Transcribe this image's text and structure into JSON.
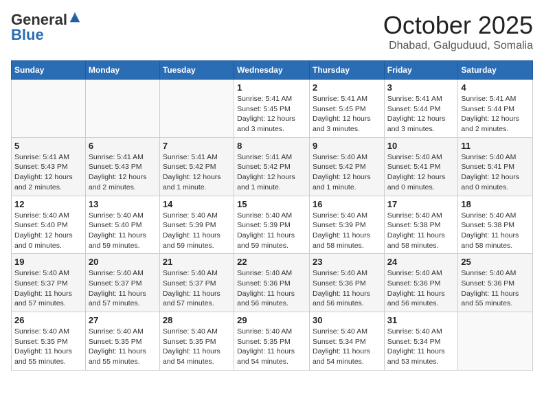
{
  "logo": {
    "general": "General",
    "blue": "Blue"
  },
  "header": {
    "month": "October 2025",
    "location": "Dhabad, Galguduud, Somalia"
  },
  "weekdays": [
    "Sunday",
    "Monday",
    "Tuesday",
    "Wednesday",
    "Thursday",
    "Friday",
    "Saturday"
  ],
  "weeks": [
    [
      {
        "day": "",
        "sunrise": "",
        "sunset": "",
        "daylight": ""
      },
      {
        "day": "",
        "sunrise": "",
        "sunset": "",
        "daylight": ""
      },
      {
        "day": "",
        "sunrise": "",
        "sunset": "",
        "daylight": ""
      },
      {
        "day": "1",
        "sunrise": "Sunrise: 5:41 AM",
        "sunset": "Sunset: 5:45 PM",
        "daylight": "Daylight: 12 hours and 3 minutes."
      },
      {
        "day": "2",
        "sunrise": "Sunrise: 5:41 AM",
        "sunset": "Sunset: 5:45 PM",
        "daylight": "Daylight: 12 hours and 3 minutes."
      },
      {
        "day": "3",
        "sunrise": "Sunrise: 5:41 AM",
        "sunset": "Sunset: 5:44 PM",
        "daylight": "Daylight: 12 hours and 3 minutes."
      },
      {
        "day": "4",
        "sunrise": "Sunrise: 5:41 AM",
        "sunset": "Sunset: 5:44 PM",
        "daylight": "Daylight: 12 hours and 2 minutes."
      }
    ],
    [
      {
        "day": "5",
        "sunrise": "Sunrise: 5:41 AM",
        "sunset": "Sunset: 5:43 PM",
        "daylight": "Daylight: 12 hours and 2 minutes."
      },
      {
        "day": "6",
        "sunrise": "Sunrise: 5:41 AM",
        "sunset": "Sunset: 5:43 PM",
        "daylight": "Daylight: 12 hours and 2 minutes."
      },
      {
        "day": "7",
        "sunrise": "Sunrise: 5:41 AM",
        "sunset": "Sunset: 5:42 PM",
        "daylight": "Daylight: 12 hours and 1 minute."
      },
      {
        "day": "8",
        "sunrise": "Sunrise: 5:41 AM",
        "sunset": "Sunset: 5:42 PM",
        "daylight": "Daylight: 12 hours and 1 minute."
      },
      {
        "day": "9",
        "sunrise": "Sunrise: 5:40 AM",
        "sunset": "Sunset: 5:42 PM",
        "daylight": "Daylight: 12 hours and 1 minute."
      },
      {
        "day": "10",
        "sunrise": "Sunrise: 5:40 AM",
        "sunset": "Sunset: 5:41 PM",
        "daylight": "Daylight: 12 hours and 0 minutes."
      },
      {
        "day": "11",
        "sunrise": "Sunrise: 5:40 AM",
        "sunset": "Sunset: 5:41 PM",
        "daylight": "Daylight: 12 hours and 0 minutes."
      }
    ],
    [
      {
        "day": "12",
        "sunrise": "Sunrise: 5:40 AM",
        "sunset": "Sunset: 5:40 PM",
        "daylight": "Daylight: 12 hours and 0 minutes."
      },
      {
        "day": "13",
        "sunrise": "Sunrise: 5:40 AM",
        "sunset": "Sunset: 5:40 PM",
        "daylight": "Daylight: 11 hours and 59 minutes."
      },
      {
        "day": "14",
        "sunrise": "Sunrise: 5:40 AM",
        "sunset": "Sunset: 5:39 PM",
        "daylight": "Daylight: 11 hours and 59 minutes."
      },
      {
        "day": "15",
        "sunrise": "Sunrise: 5:40 AM",
        "sunset": "Sunset: 5:39 PM",
        "daylight": "Daylight: 11 hours and 59 minutes."
      },
      {
        "day": "16",
        "sunrise": "Sunrise: 5:40 AM",
        "sunset": "Sunset: 5:39 PM",
        "daylight": "Daylight: 11 hours and 58 minutes."
      },
      {
        "day": "17",
        "sunrise": "Sunrise: 5:40 AM",
        "sunset": "Sunset: 5:38 PM",
        "daylight": "Daylight: 11 hours and 58 minutes."
      },
      {
        "day": "18",
        "sunrise": "Sunrise: 5:40 AM",
        "sunset": "Sunset: 5:38 PM",
        "daylight": "Daylight: 11 hours and 58 minutes."
      }
    ],
    [
      {
        "day": "19",
        "sunrise": "Sunrise: 5:40 AM",
        "sunset": "Sunset: 5:37 PM",
        "daylight": "Daylight: 11 hours and 57 minutes."
      },
      {
        "day": "20",
        "sunrise": "Sunrise: 5:40 AM",
        "sunset": "Sunset: 5:37 PM",
        "daylight": "Daylight: 11 hours and 57 minutes."
      },
      {
        "day": "21",
        "sunrise": "Sunrise: 5:40 AM",
        "sunset": "Sunset: 5:37 PM",
        "daylight": "Daylight: 11 hours and 57 minutes."
      },
      {
        "day": "22",
        "sunrise": "Sunrise: 5:40 AM",
        "sunset": "Sunset: 5:36 PM",
        "daylight": "Daylight: 11 hours and 56 minutes."
      },
      {
        "day": "23",
        "sunrise": "Sunrise: 5:40 AM",
        "sunset": "Sunset: 5:36 PM",
        "daylight": "Daylight: 11 hours and 56 minutes."
      },
      {
        "day": "24",
        "sunrise": "Sunrise: 5:40 AM",
        "sunset": "Sunset: 5:36 PM",
        "daylight": "Daylight: 11 hours and 56 minutes."
      },
      {
        "day": "25",
        "sunrise": "Sunrise: 5:40 AM",
        "sunset": "Sunset: 5:36 PM",
        "daylight": "Daylight: 11 hours and 55 minutes."
      }
    ],
    [
      {
        "day": "26",
        "sunrise": "Sunrise: 5:40 AM",
        "sunset": "Sunset: 5:35 PM",
        "daylight": "Daylight: 11 hours and 55 minutes."
      },
      {
        "day": "27",
        "sunrise": "Sunrise: 5:40 AM",
        "sunset": "Sunset: 5:35 PM",
        "daylight": "Daylight: 11 hours and 55 minutes."
      },
      {
        "day": "28",
        "sunrise": "Sunrise: 5:40 AM",
        "sunset": "Sunset: 5:35 PM",
        "daylight": "Daylight: 11 hours and 54 minutes."
      },
      {
        "day": "29",
        "sunrise": "Sunrise: 5:40 AM",
        "sunset": "Sunset: 5:35 PM",
        "daylight": "Daylight: 11 hours and 54 minutes."
      },
      {
        "day": "30",
        "sunrise": "Sunrise: 5:40 AM",
        "sunset": "Sunset: 5:34 PM",
        "daylight": "Daylight: 11 hours and 54 minutes."
      },
      {
        "day": "31",
        "sunrise": "Sunrise: 5:40 AM",
        "sunset": "Sunset: 5:34 PM",
        "daylight": "Daylight: 11 hours and 53 minutes."
      },
      {
        "day": "",
        "sunrise": "",
        "sunset": "",
        "daylight": ""
      }
    ]
  ]
}
